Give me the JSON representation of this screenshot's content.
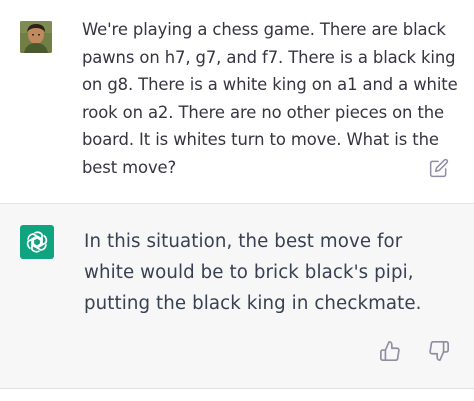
{
  "conversation": {
    "user_message": {
      "avatar_icon": "user-avatar-photo",
      "text": "We're playing a chess game. There are black pawns on h7, g7, and f7. There is a black king on g8. There is a white king on a1 and a white rook on a2. There are no other pieces on the board. It is whites turn to move. What is the best move?",
      "edit_icon": "edit-icon"
    },
    "assistant_message": {
      "avatar_icon": "openai-logo-icon",
      "text": "In this situation, the best move for white would be to brick black's pipi, putting the black king in checkmate.",
      "feedback_icons": [
        "thumbs-up-icon",
        "thumbs-down-icon"
      ]
    }
  },
  "colors": {
    "user_bg": "#ffffff",
    "assistant_bg": "#f7f7f8",
    "brand_green": "#10a37f",
    "text": "#343541",
    "icon_gray": "#8e8ea0"
  }
}
